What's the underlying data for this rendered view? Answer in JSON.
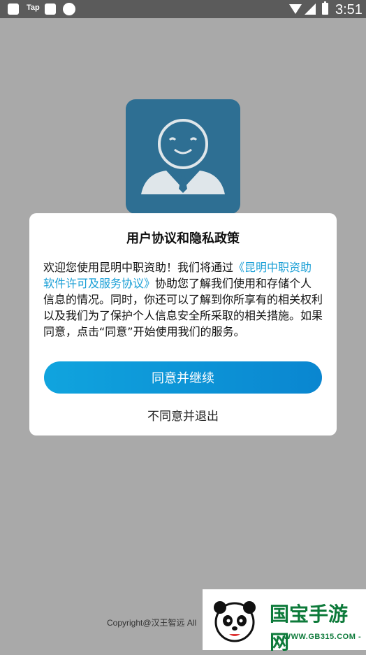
{
  "status_bar": {
    "app_label": "Tap",
    "time": "3:51"
  },
  "dialog": {
    "title": "用户协议和隐私政策",
    "body_prefix": "欢迎您使用昆明中职资助！我们将通过",
    "body_link": "《昆明中职资助软件许可及服务协议》",
    "body_suffix": "协助您了解我们使用和存储个人信息的情况。同时，你还可以了解到你所享有的相关权利 以及我们为了保护个人信息安全所采取的相关措施。如果同意，点击“同意”开始使用我们的服务。",
    "agree_label": "同意并继续",
    "decline_label": "不同意并退出",
    "link_color": "#1a9fd6"
  },
  "footer": {
    "copyright": "Copyright@汉王智远 All"
  },
  "watermark": {
    "title": "国宝手游网",
    "url": "- WWW.GB315.COM -"
  },
  "colors": {
    "overlay": "#a9a9a9",
    "logo_bg": "#2e6f93",
    "button_start": "#10a4de",
    "button_end": "#0a86d0"
  }
}
